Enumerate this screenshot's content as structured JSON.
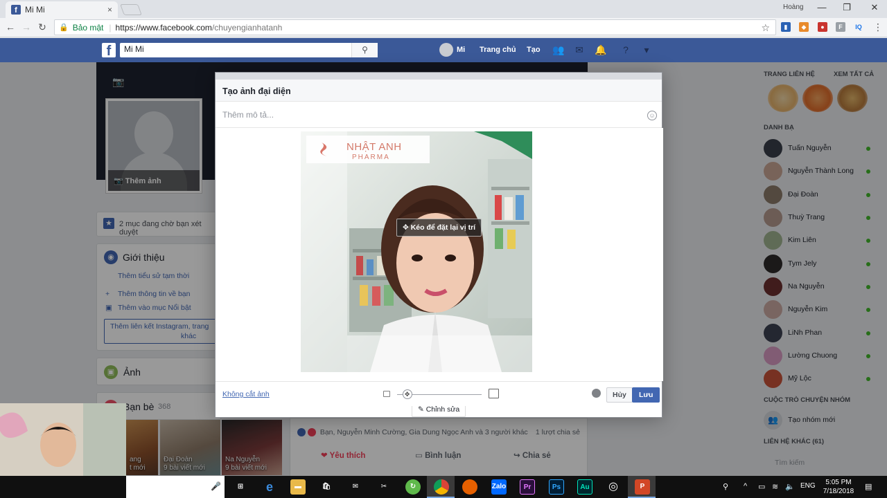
{
  "browser": {
    "tab_title": "Mi Mi",
    "tab_close": "×",
    "window_user": "Hoàng",
    "win_min": "—",
    "win_max": "❐",
    "win_close": "✕",
    "secure_label": "Bảo mật",
    "url_host": "https://www.facebook.com",
    "url_path": "/chuyengianhatanh",
    "ext_iq": "IQ"
  },
  "fb_header": {
    "logo": "f",
    "search_value": "Mi Mi",
    "profile_name": "Mi",
    "home_label": "Trang chủ",
    "create_label": "Tạo"
  },
  "profile": {
    "add_photo_label": "Thêm ảnh",
    "pending_text": "2 mục đang chờ bạn xét duyệt",
    "intro_title": "Giới thiệu",
    "intro_link": "Thêm tiểu sử tạm thời",
    "add_info": "Thêm thông tin về bạn",
    "add_featured": "Thêm vào mục Nổi bật",
    "add_links_1": "Thêm liên kết Instagram, trang",
    "add_links_2": "khác",
    "photos_title": "Ảnh",
    "friends_title": "Bạn bè",
    "friends_count": "368"
  },
  "friend_thumbs": [
    {
      "name": "ang",
      "posts": "t mới"
    },
    {
      "name": "Đại Đoàn",
      "posts": "9 bài viết mới"
    },
    {
      "name": "Na Nguyễn",
      "posts": "9 bài viết mới"
    }
  ],
  "feed": {
    "reactions_text": "Bạn, Nguyễn Minh Cường, Gia Dung Ngọc Anh và 3 người khác",
    "shares_text": "1 lượt chia sẻ",
    "like_label": "Yêu thích",
    "comment_label": "Bình luận",
    "share_label": "Chia sẻ"
  },
  "modal": {
    "title": "Tạo ảnh đại diện",
    "description_placeholder": "Thêm mô tả...",
    "drag_hint": "Kéo để đặt lại vị trí",
    "edit_label": "Chỉnh sửa",
    "no_crop_label": "Không cắt ảnh",
    "cancel_label": "Hủy",
    "save_label": "Lưu",
    "zoom_level": 0.12,
    "photo_logo_text": "NHẬT ANH",
    "photo_logo_sub": "PHARMA"
  },
  "sidebar": {
    "pages_title": "TRANG LIÊN HỆ",
    "see_all": "XEM TẤT CẢ",
    "friends_title": "DANH BẠ",
    "contacts": [
      {
        "name": "Tuấn Nguyễn",
        "color": "#3a3f4a",
        "online": true
      },
      {
        "name": "Nguyễn Thành Long",
        "color": "#c9a595",
        "online": true
      },
      {
        "name": "Đại Đoàn",
        "color": "#8a7a6a",
        "online": true
      },
      {
        "name": "Thuỳ Trang",
        "color": "#b49a8e",
        "online": true
      },
      {
        "name": "Kim Liên",
        "color": "#9fb28f",
        "online": true
      },
      {
        "name": "Tym Jely",
        "color": "#2e2a2a",
        "online": true
      },
      {
        "name": "Na Nguyễn",
        "color": "#6b2f2f",
        "online": true
      },
      {
        "name": "Nguyễn Kim",
        "color": "#caa9a2",
        "online": true
      },
      {
        "name": "LiNh Phan",
        "color": "#3d4252",
        "online": true
      },
      {
        "name": "Lường Chuong",
        "color": "#d79ac2",
        "online": true
      },
      {
        "name": "Mỹ Lộc",
        "color": "#c6533a",
        "online": true
      }
    ],
    "group_title": "CUỘC TRÒ CHUYỆN NHÓM",
    "new_group": "Tạo nhóm mới",
    "other_contacts": "LIÊN HỆ KHÁC (61)",
    "search_placeholder": "Tìm kiếm"
  },
  "taskbar": {
    "lang": "ENG",
    "time": "5:05 PM",
    "date": "7/18/2018"
  }
}
